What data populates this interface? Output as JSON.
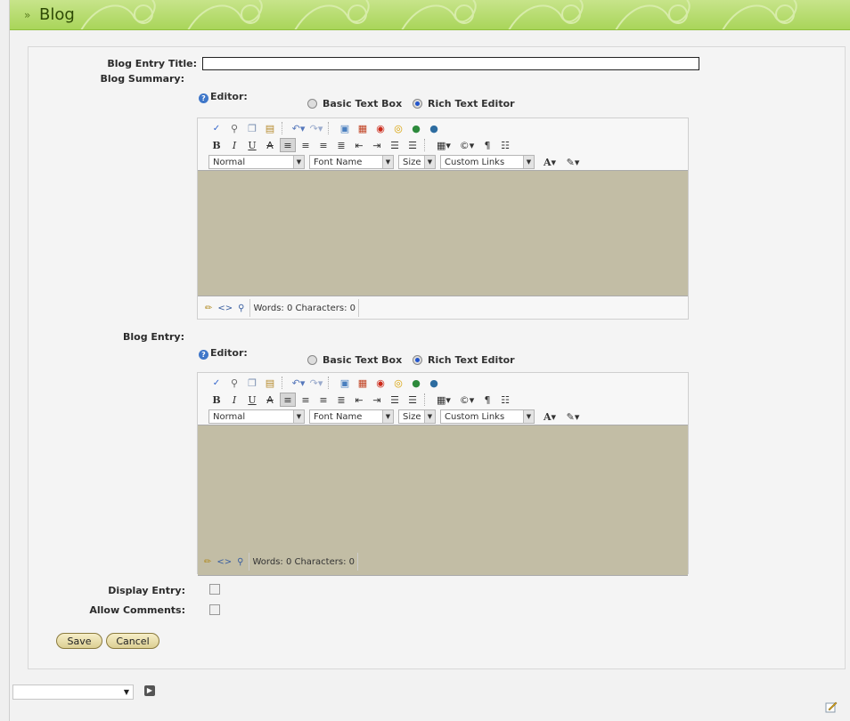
{
  "header": {
    "title": "Blog",
    "chevron": "»",
    "bg_color": "#b6dd6f"
  },
  "form": {
    "entry_title_label": "Blog Entry Title:",
    "entry_title_value": "",
    "summary_label": "Blog Summary:",
    "entry_label": "Blog Entry:",
    "display_entry_label": "Display Entry:",
    "allow_comments_label": "Allow Comments:",
    "display_entry_checked": false,
    "allow_comments_checked": false
  },
  "editor_toggle": {
    "label": "Editor:",
    "basic_option": "Basic Text Box",
    "rich_option": "Rich Text Editor",
    "selected": "Rich Text Editor"
  },
  "rte": {
    "format_select": "Normal",
    "font_select": "Font Name",
    "size_select": "Size",
    "links_select": "Custom Links",
    "status_text": "Words: 0 Characters: 0",
    "edit_area_color": "#c2bda5"
  },
  "buttons": {
    "save": "Save",
    "cancel": "Cancel"
  },
  "footer": {
    "select_value": ""
  },
  "icons": {
    "toolbar_row1": [
      "spellcheck-icon",
      "find-icon",
      "copy-icon",
      "paste-icon",
      "undo-icon",
      "redo-icon",
      "image-icon",
      "media-icon",
      "flash-icon",
      "special-icon",
      "link-icon",
      "unlink-icon"
    ],
    "toolbar_row2": [
      "bold-icon",
      "italic-icon",
      "underline-icon",
      "strikethrough-icon",
      "align-left-icon",
      "align-center-icon",
      "align-right-icon",
      "justify-icon",
      "outdent-icon",
      "indent-icon",
      "ordered-list-icon",
      "unordered-list-icon",
      "table-icon",
      "symbol-icon",
      "paragraph-icon",
      "line-spacing-icon"
    ]
  }
}
